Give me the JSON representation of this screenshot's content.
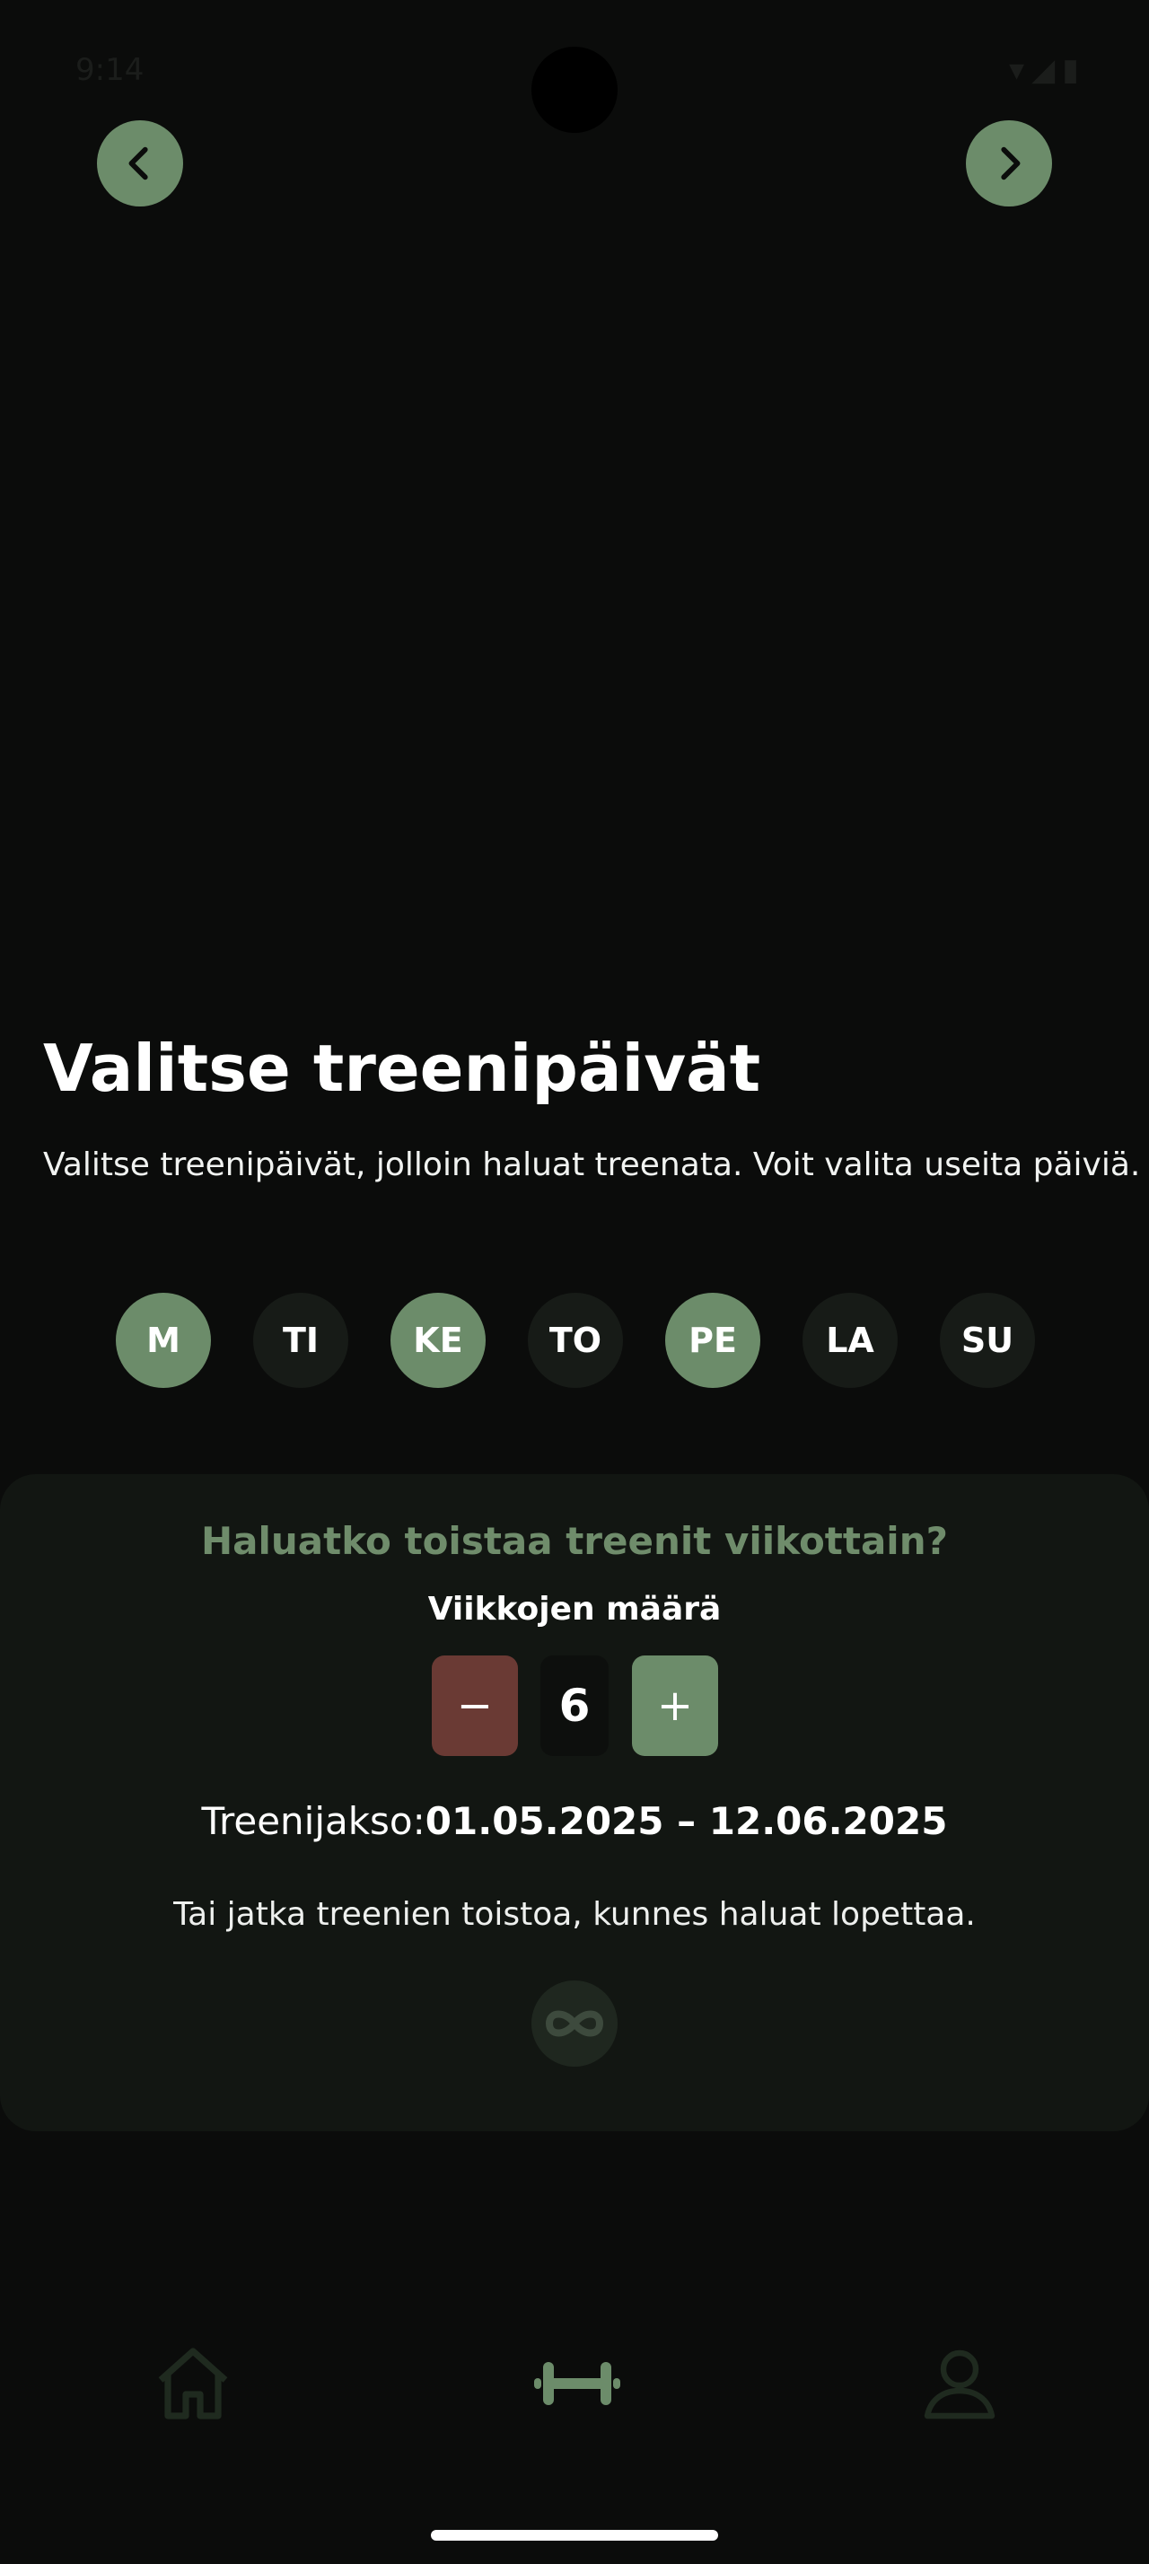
{
  "status_bar": {
    "time": "9:14",
    "icons": [
      "wifi-icon",
      "signal-icon",
      "battery-icon"
    ]
  },
  "header": {
    "back_icon": "chevron-left-icon",
    "next_icon": "chevron-right-icon"
  },
  "main": {
    "title": "Valitse treenipäivät",
    "subtitle": "Valitse treenipäivät, jolloin haluat treenata. Voit valita useita päiviä.",
    "days": [
      {
        "label": "M",
        "selected": true
      },
      {
        "label": "TI",
        "selected": false
      },
      {
        "label": "KE",
        "selected": true
      },
      {
        "label": "TO",
        "selected": false
      },
      {
        "label": "PE",
        "selected": true
      },
      {
        "label": "LA",
        "selected": false
      },
      {
        "label": "SU",
        "selected": false
      }
    ]
  },
  "repeat": {
    "question": "Haluatko toistaa treenit viikottain?",
    "weeks_label": "Viikkojen määrä",
    "minus_label": "−",
    "plus_label": "+",
    "weeks_value": "6",
    "period_label": "Treenijakso:",
    "period_value": "01.05.2025 – 12.06.2025",
    "continue_text": "Tai jatka treenien toistoa, kunnes haluat lopettaa.",
    "infinity_icon": "infinity-icon"
  },
  "bottom_nav": {
    "items": [
      "home-icon",
      "dumbbell-icon",
      "user-icon"
    ],
    "active": "dumbbell-icon"
  },
  "colors": {
    "accent": "#6c8c6a",
    "danger": "#6a3a34",
    "background": "#0b0c0b",
    "card": "#121612",
    "muted_accent": "#6f8c6b"
  }
}
